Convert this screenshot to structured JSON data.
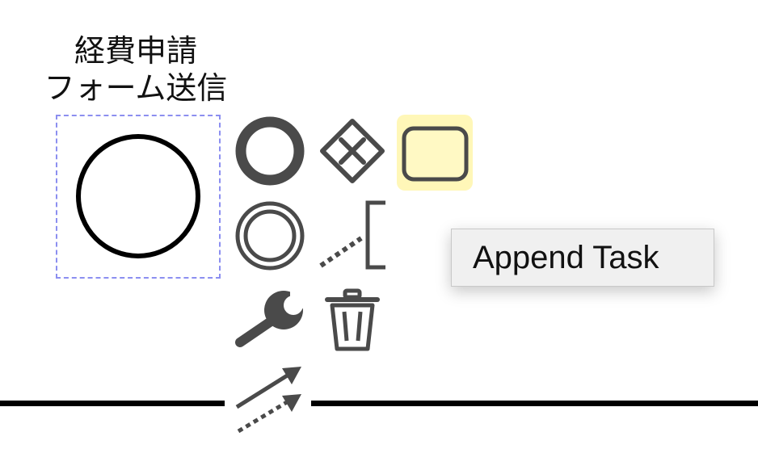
{
  "event": {
    "label_line1": "経費申請",
    "label_line2": "フォーム送信",
    "type": "start-event"
  },
  "context_pad": {
    "items": [
      {
        "name": "append-end-event",
        "icon": "end-event-icon"
      },
      {
        "name": "append-gateway",
        "icon": "gateway-icon"
      },
      {
        "name": "append-task",
        "icon": "task-icon",
        "highlighted": true
      },
      {
        "name": "append-intermediate-event",
        "icon": "intermediate-event-icon"
      },
      {
        "name": "connect-text-annotation",
        "icon": "text-annotation-icon"
      },
      {
        "name": "change-type",
        "icon": "wrench-icon"
      },
      {
        "name": "delete",
        "icon": "trash-icon"
      },
      {
        "name": "connect",
        "icon": "connect-arrows-icon"
      }
    ]
  },
  "tooltip": {
    "text": "Append Task"
  },
  "colors": {
    "selection_outline": "#8c8ff0",
    "task_fill": "#fff9c4",
    "task_highlight_bg": "#fff7b8",
    "icon_gray": "#4a4a4a"
  }
}
